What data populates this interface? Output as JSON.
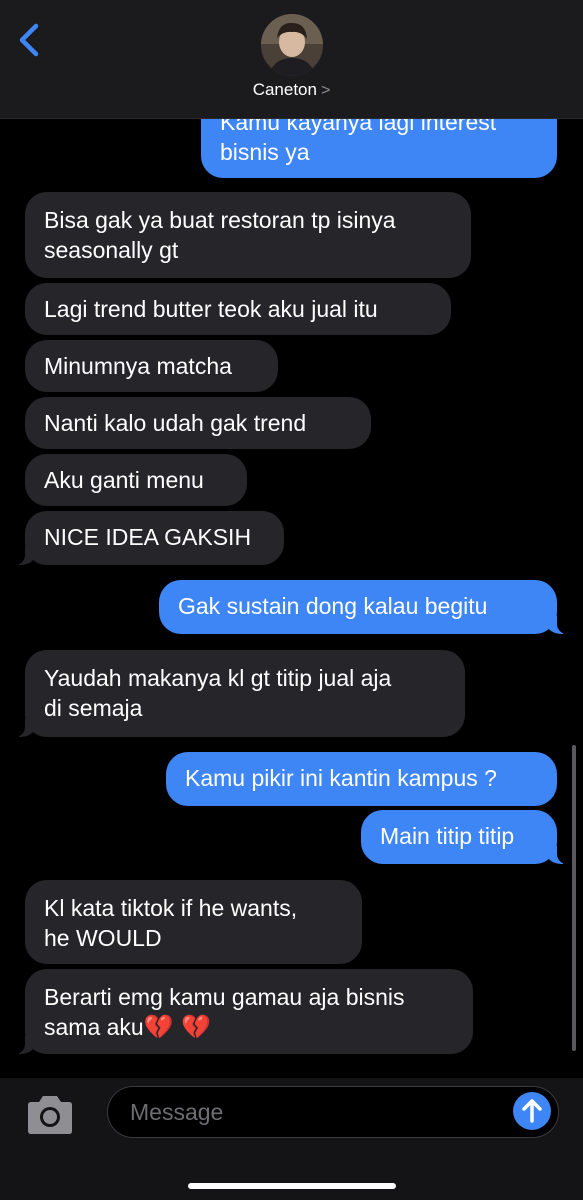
{
  "header": {
    "contact_name": "Caneton",
    "contact_chevron": ">"
  },
  "messages": [
    {
      "side": "out",
      "lines": [
        "Kamu kayanya lagi interest",
        "bisnis ya"
      ]
    },
    {
      "side": "in",
      "lines": [
        "Bisa gak ya buat restoran tp isinya",
        "seasonally gt"
      ]
    },
    {
      "side": "in",
      "lines": [
        "Lagi trend butter teok aku jual itu"
      ]
    },
    {
      "side": "in",
      "lines": [
        "Minumnya matcha"
      ]
    },
    {
      "side": "in",
      "lines": [
        "Nanti kalo udah gak trend"
      ]
    },
    {
      "side": "in",
      "lines": [
        "Aku ganti menu"
      ]
    },
    {
      "side": "in",
      "lines": [
        "NICE IDEA GAKSIH"
      ]
    },
    {
      "side": "out",
      "lines": [
        "Gak sustain dong kalau begitu"
      ]
    },
    {
      "side": "in",
      "lines": [
        "Yaudah makanya kl gt titip jual aja",
        "di semaja"
      ]
    },
    {
      "side": "out",
      "lines": [
        "Kamu pikir ini kantin kampus ?"
      ]
    },
    {
      "side": "out",
      "lines": [
        "Main titip titip"
      ]
    },
    {
      "side": "in",
      "lines": [
        "Kl kata tiktok if he wants,",
        "he WOULD"
      ]
    },
    {
      "side": "in",
      "lines": [
        "Berarti emg kamu gamau aja bisnis",
        "sama aku"
      ],
      "emoji": "💔 💔"
    }
  ],
  "composer": {
    "placeholder": "Message"
  },
  "colors": {
    "outgoing": "#3e86f5",
    "incoming": "#26252a",
    "accent": "#3e86f5"
  },
  "icons": {
    "back": "chevron-left-icon",
    "camera": "camera-icon",
    "send": "arrow-up-icon"
  }
}
